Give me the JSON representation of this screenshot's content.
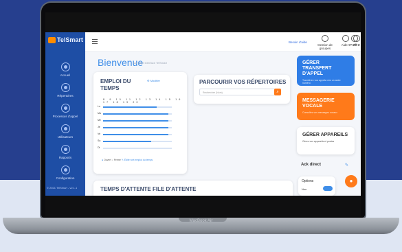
{
  "app": {
    "logo_text": "TelSmart",
    "brand_label": "MacBook Air",
    "colors": {
      "sidebar": "#1e4ea5",
      "accent": "#3f8ee8",
      "orange": "#ff7a1a"
    }
  },
  "sidebar": {
    "items": [
      {
        "label": "Accueil",
        "icon": "home-icon"
      },
      {
        "label": "Répertoires",
        "icon": "contacts-icon"
      },
      {
        "label": "Processus d'appel",
        "icon": "flow-icon"
      },
      {
        "label": "Utilisateurs",
        "icon": "users-icon"
      },
      {
        "label": "Rapports",
        "icon": "report-icon"
      },
      {
        "label": "Configuration",
        "icon": "settings-icon"
      }
    ],
    "version": "© 2021 TelSmart - v2.1.1"
  },
  "topbar": {
    "link": "Besoin d'aide",
    "items": [
      {
        "label": "Gestion de groupes",
        "icon": "group-icon"
      },
      {
        "label": "Aide ▾",
        "icon": "help-icon"
      },
      {
        "label": "FR ▾",
        "icon": "globe-icon"
      },
      {
        "label": "Profil ▾",
        "icon": "profile-icon"
      }
    ]
  },
  "header": {
    "title": "Bienvenue",
    "subtitle": "sur votre interface TelSmart"
  },
  "schedule_card": {
    "title_line1": "EMPLOI DU",
    "title_line2": "TEMPS",
    "button": "Modifier",
    "hours": [
      "8",
      "9",
      "10",
      "11",
      "12",
      "13",
      "14",
      "15",
      "16",
      "17",
      "18",
      "19",
      "20"
    ],
    "days": [
      "Lu",
      "Ma",
      "Me",
      "Je",
      "Ve",
      "Sa",
      "Di"
    ],
    "day_fill": [
      0.78,
      0.95,
      0.95,
      0.95,
      0.95,
      0.7,
      0.0
    ],
    "legend": [
      "Ouvert",
      "Fermé",
      "Éditer cet emploi du temps"
    ]
  },
  "browse_card": {
    "title": "PARCOURIR VOS RÉPERTOIRES",
    "placeholder": "Rechercher (Nom)",
    "search_icon": "search-icon"
  },
  "tiles": [
    {
      "title": "GÉRER TRANSFERT D'APPEL",
      "text": "Transférez vos appels vers un autre numéro",
      "color": "#2f7de6"
    },
    {
      "title": "MESSAGERIE VOCALE",
      "text": "Consultez vos messages vocaux",
      "color": "#ff7a1a"
    },
    {
      "title": "GÉRER APPAREILS",
      "text": "Gérez vos appareils et postes",
      "color": "#ffffff"
    }
  ],
  "right_panel": {
    "title": "Ack direct",
    "options_label": "Options",
    "toggle_label": "Non"
  },
  "wait_card": {
    "title": "TEMPS D'ATTENTE FILE D'ATTENTE"
  }
}
